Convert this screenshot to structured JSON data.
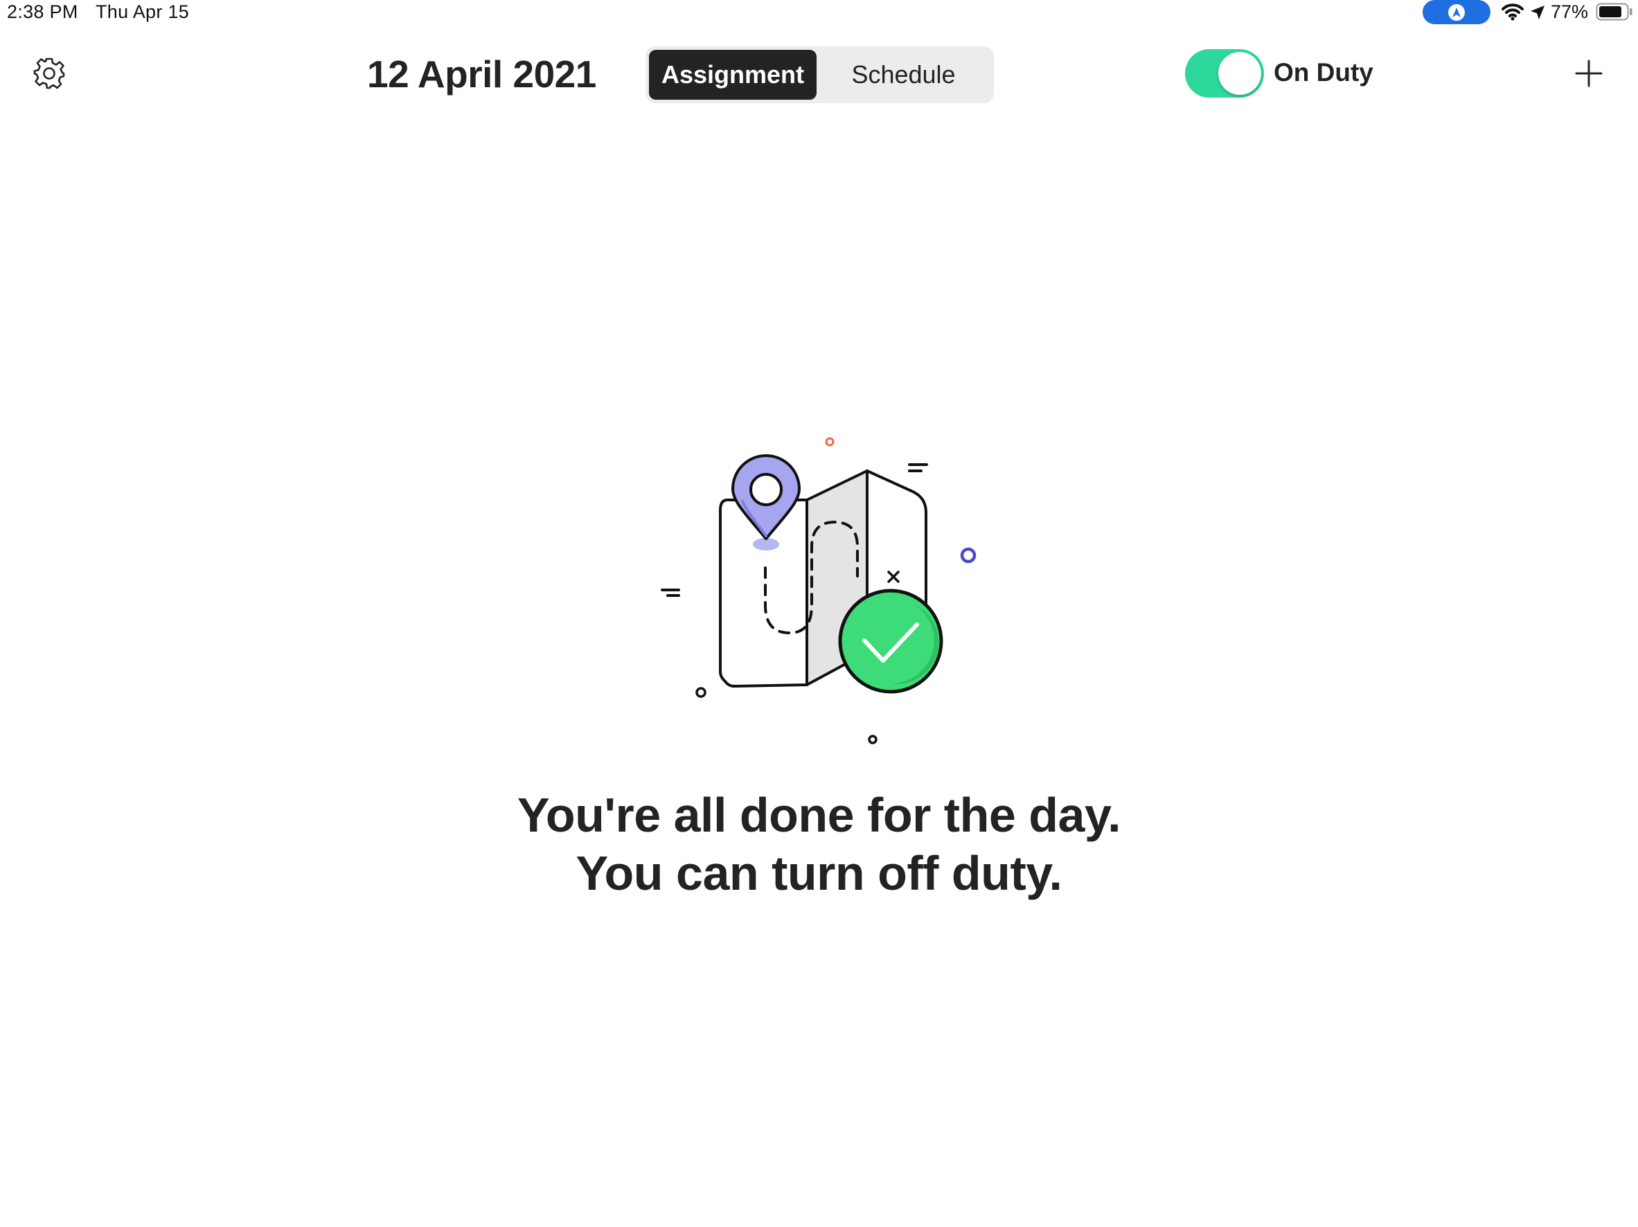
{
  "status_bar": {
    "time": "2:38 PM",
    "date": "Thu Apr 15",
    "battery": "77%"
  },
  "header": {
    "title": "12 April 2021",
    "tabs": [
      {
        "label": "Assignment",
        "active": true
      },
      {
        "label": "Schedule",
        "active": false
      }
    ],
    "duty_label": "On Duty",
    "duty_on": true
  },
  "empty_state": {
    "line1": "You're all done for the day.",
    "line2": "You can turn off duty."
  },
  "colors": {
    "toggle_on": "#2ed89a",
    "active_tab": "#232323",
    "pin": "#a6a6f0",
    "check": "#3ddc78"
  },
  "icons": [
    "gear-icon",
    "plus-icon",
    "wifi-icon",
    "location-arrow-icon",
    "battery-icon",
    "map-illustration"
  ]
}
